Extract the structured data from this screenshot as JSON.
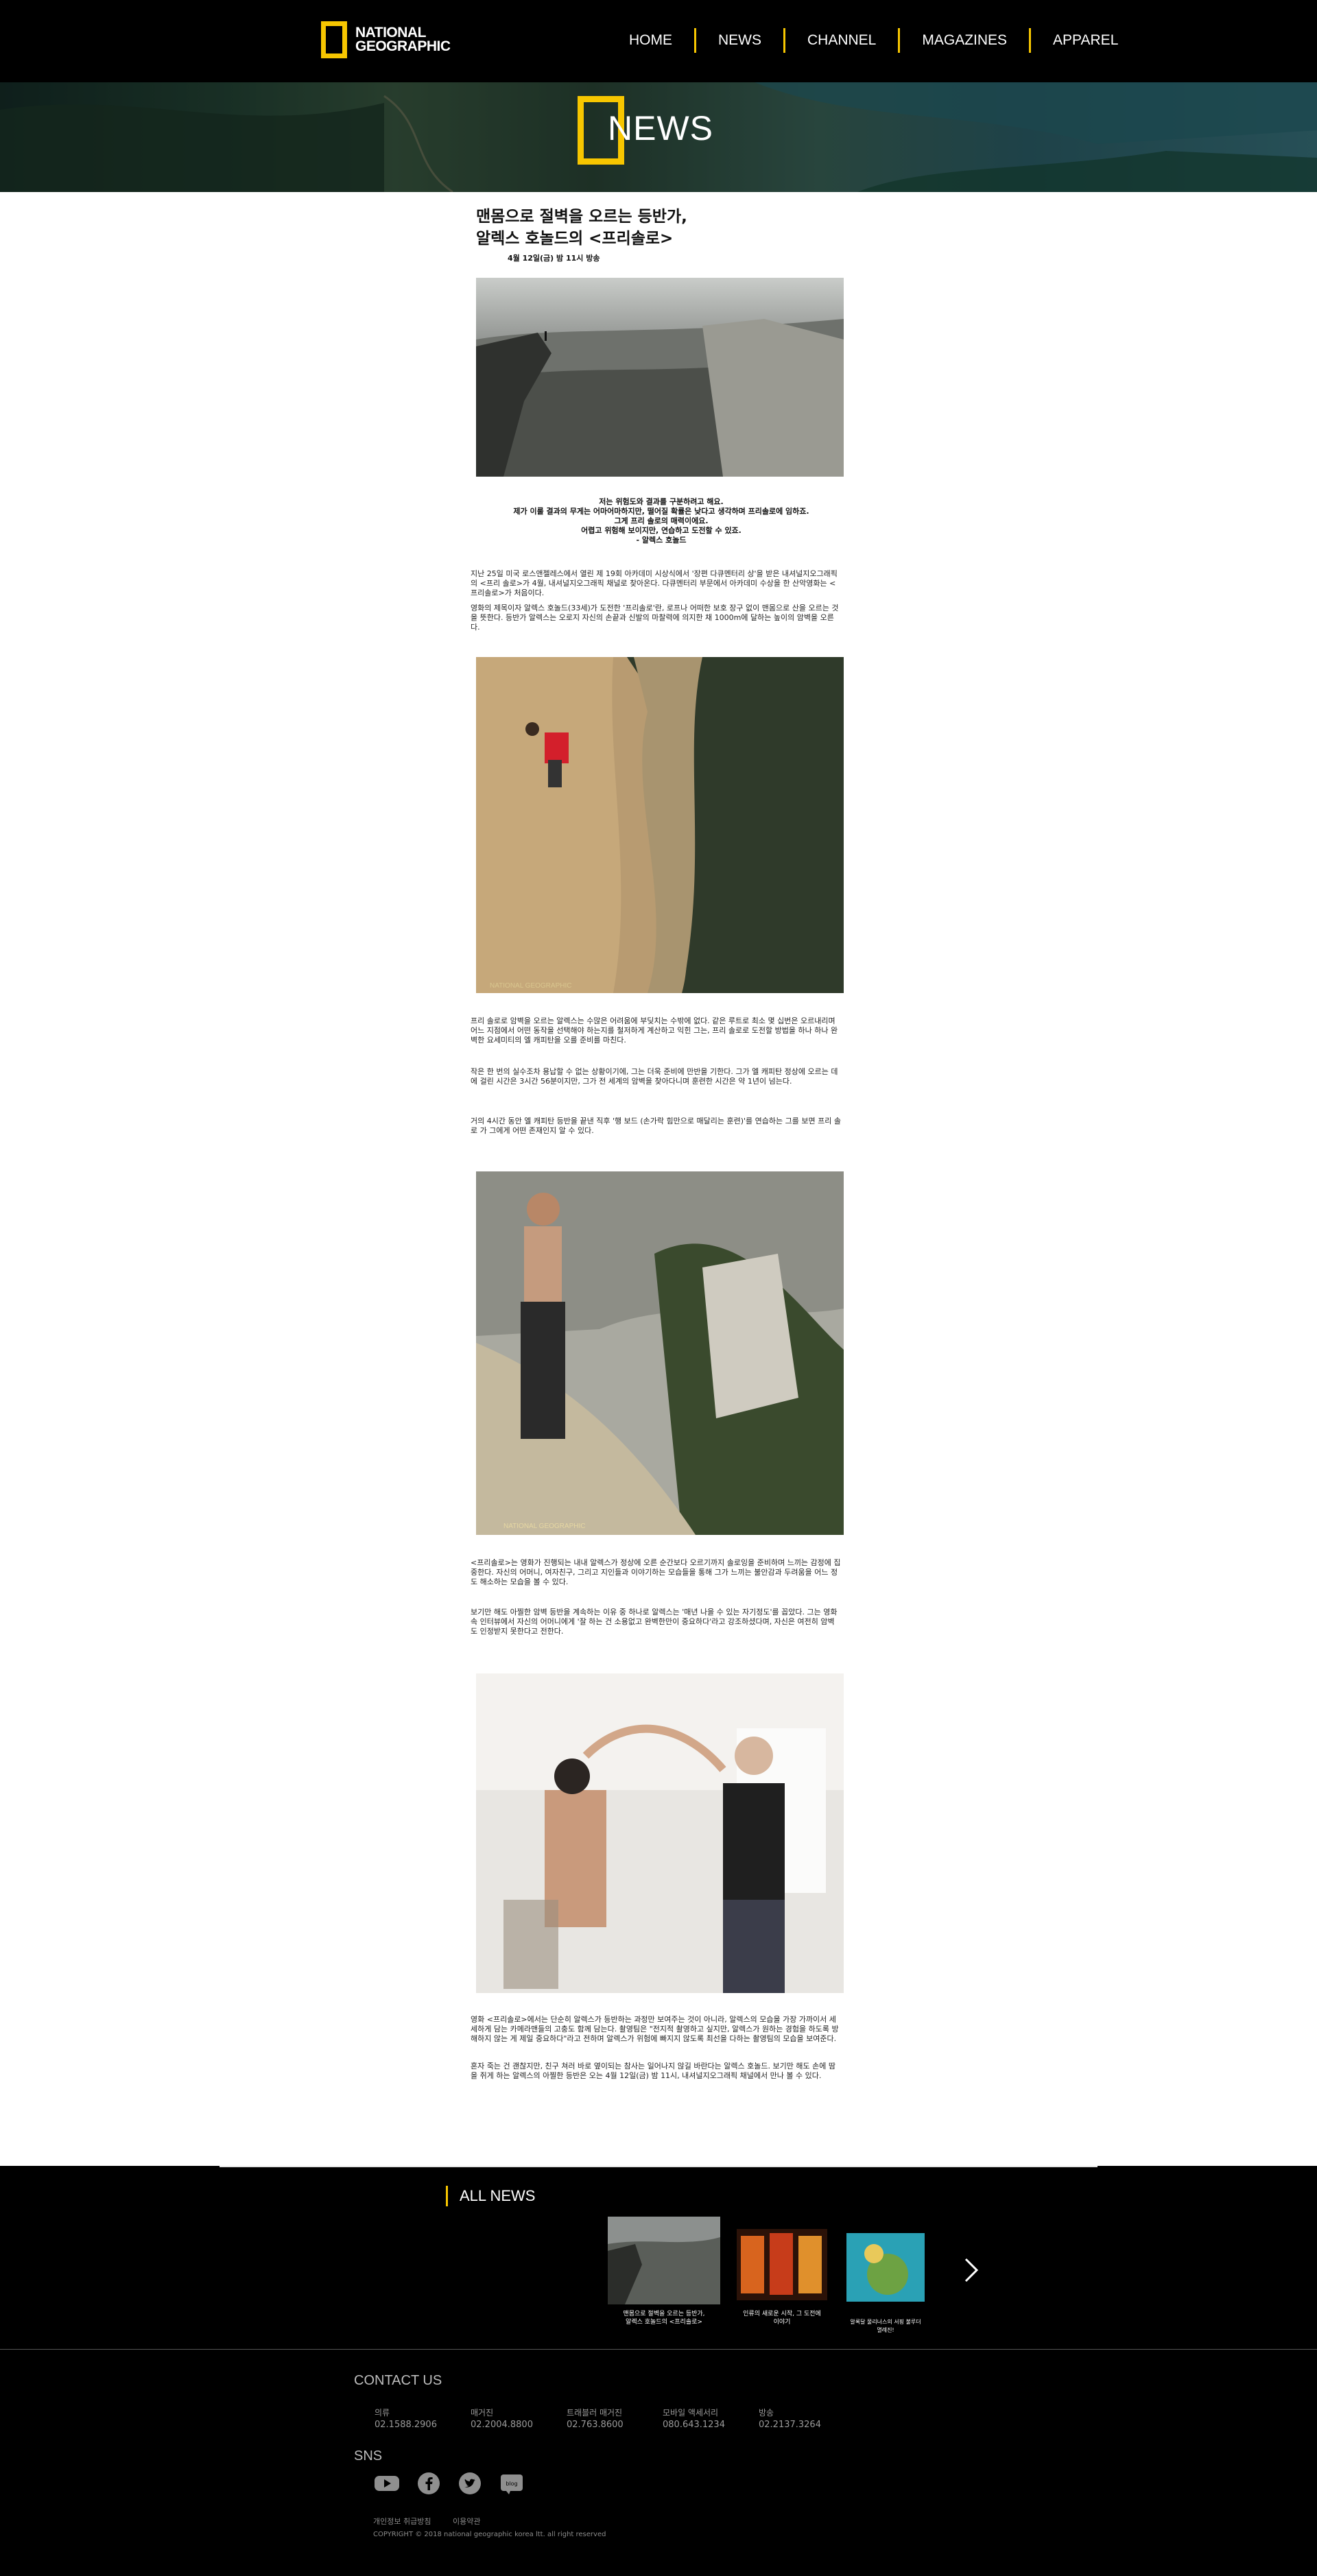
{
  "header": {
    "logo": "NATIONAL GEOGRAPHIC",
    "logo_line1": "NATIONAL",
    "logo_line2": "GEOGRAPHIC",
    "nav": [
      "HOME",
      "NEWS",
      "CHANNEL",
      "MAGAZINES",
      "APPAREL"
    ],
    "brand_color": "#f7c600"
  },
  "banner": {
    "title": "NEWS"
  },
  "article": {
    "title_line1": "맨몸으로 절벽을 오르는 등반가,",
    "title_line2": "알렉스 호놀드의 <프리솔로>",
    "date": "4월 12일(금) 밤 11시 방송",
    "quote": [
      "저는 위험도와 결과를 구분하려고 해요.",
      "제가 이룰 결과의 무게는 어마어마하지만, 떨어질 확률은 낮다고 생각하며 프리솔로에 임하죠.",
      "그게 프리 솔로의 매력이에요.",
      "어렵고 위험해 보이지만, 연습하고 도전할 수 있죠.",
      "- 알렉스 호놀드"
    ],
    "p1": "지난 25일 미국 로스앤젤레스에서 열린 제 19회 아카데미 시상식에서 '장편 다큐멘터리 상'을 받은 내셔널지오그래픽의 <프리 솔로>가 4월, 내셔널지오그래픽 채널로 찾아온다. 다큐멘터리 부문에서 아카데미 수상을 한 산악영화는 <프리솔로>가 처음이다.",
    "p2": "영화의 제목이자 알렉스 호놀드(33세)가 도전한 '프리솔로'란, 로프나 어떠한 보호 장구 없이 맨몸으로 산을 오르는 것을 뜻한다. 등반가 알렉스는 오로지 자신의 손끝과 신발의 마찰력에 의지한 채 1000m에 달하는 높이의 암벽을 오른다.",
    "p3": "프리 솔로로 암벽을 오르는 알렉스는 수많은 어려움에 부딪치는 수밖에 없다. 같은 루트로 최소 몇 십번은 오르내리며 어느 지점에서 어떤 동작을 선택해야 하는지를 철저하게 계산하고 익힌 그는, 프리 솔로로 도전할 방법을 하나 하나 완벽한 요세미티의 엘 캐피탄을 오를 준비를 마친다.",
    "p4": "작은 한 번의 실수조차 용납할 수 없는 상황이기에, 그는 더욱 준비에 만반을 기한다. 그가 엘 캐피탄 정상에 오르는 데에 걸린 시간은 3시간 56분이지만, 그가 전 세계의 암벽을 찾아다니며 훈련한 시간은 약 1년이 넘는다.",
    "p5": "거의 4시간 동안 엘 캐피탄 등반을 끝낸 직후 '행 보드 (손가락 힘만으로 매달리는 훈련)'를 연습하는 그를 보면 프리 솔로 가 그에게 어떤 존재인지 알 수 있다.",
    "p6": "<프리솔로>는 영화가 진행되는 내내 알렉스가 정상에 오른 순간보다 오르기까지 솔로잉을 준비하며 느끼는 감정에 집중한다. 자신의 어머니, 여자친구, 그리고 지인들과 이야기하는 모습들을 통해 그가 느끼는 불안감과 두려움을 어느 정도 해소하는 모습을 볼 수 있다.",
    "p7": "보기만 해도 아찔한 암벽 등반을 계속하는 이유 중 하나로 알렉스는 '매년 나을 수 있는 자기정도'를 꼽았다. 그는 영화 속 인터뷰에서 자신의 어머니에게 '잘 하는 건 소용없고 완벽한만이 중요하다'라고 강조하셨다며, 자신은 여전히 암벽도 인정받지 못한다고 전한다.",
    "p8": "영화 <프리솔로>에서는 단순히 알렉스가 등반하는 과정만 보여주는 것이 아니라, 알렉스의 모습을 가장 가까이서 세세하게 담는 카메라맨들의 고충도 함께 담는다. 촬영팀은 \"전지적 촬영하고 싶지만, 알렉스가 원하는 경험을 하도록 방해하지 않는 게 제일 중요하다\"라고 전하며 알렉스가 위험에 빠지지 않도록 최선을 다하는 촬영팀의 모습을 보여준다.",
    "p9": "혼자 죽는 건 괜찮지만, 친구 쳐러 바로 옆이되는 참사는 일어나지 않길 바란다는 알렉스 호놀드. 보기만 해도 손에 땀을 쥐게 하는 알렉스의 아찔한 등반은 오는 4월 12일(금) 밤 11시, 내셔널지오그래픽 채널에서 만나 볼 수 있다.",
    "watermark": "NATIONAL GEOGRAPHIC"
  },
  "all_news": {
    "title": "ALL NEWS",
    "items": [
      {
        "caption_line1": "맨몸으로 절벽을 오르는 등반가,",
        "caption_line2": "알렉스 호놀드의 <프리솔로>"
      },
      {
        "caption_line1": "인류의 새로운 시작, 그 도전에",
        "caption_line2": "이야기"
      },
      {
        "caption_line1": "알록달 물리너스의 서핑 불루더",
        "caption_line2": "멸례진!"
      }
    ],
    "next_icon": "chevron-right-icon"
  },
  "footer": {
    "contact_title": "CONTACT US",
    "contacts": [
      {
        "label": "의류",
        "value": "02.1588.2906"
      },
      {
        "label": "매거진",
        "value": "02.2004.8800"
      },
      {
        "label": "트래블러 매거진",
        "value": "02.763.8600"
      },
      {
        "label": "모바일 액세서리",
        "value": "080.643.1234"
      },
      {
        "label": "방송",
        "value": "02.2137.3264"
      }
    ],
    "sns_title": "SNS",
    "sns_icons": [
      "youtube-icon",
      "facebook-icon",
      "twitter-icon",
      "blog-icon"
    ],
    "blog_label": "blog",
    "links": [
      "개인정보 취급방침",
      "이용약관"
    ],
    "copyright": "COPYRIGHT © 2018 national geographic korea ltt. all right reserved"
  }
}
